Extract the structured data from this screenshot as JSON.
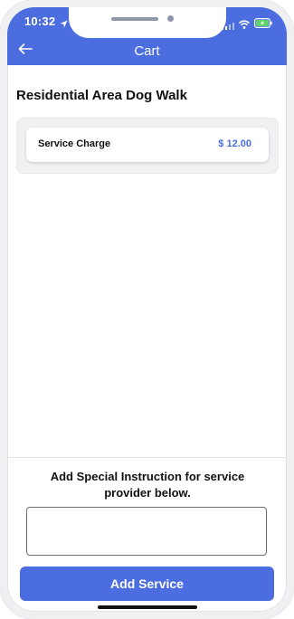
{
  "status_bar": {
    "time": "10:32"
  },
  "header": {
    "title": "Cart",
    "color": "#4b6de0"
  },
  "service": {
    "name": "Residential Area Dog Walk"
  },
  "charges": [
    {
      "label": "Service Charge",
      "value": "$ 12.00"
    }
  ],
  "instruction": {
    "text": "Add Special Instruction for service provider below.",
    "input_value": ""
  },
  "footer": {
    "add_button_label": "Add Service"
  },
  "icons": [
    "location-icon",
    "signal-icon",
    "wifi-icon",
    "battery-icon",
    "back-arrow-icon"
  ]
}
